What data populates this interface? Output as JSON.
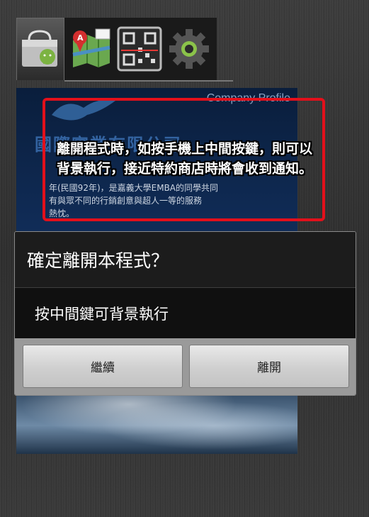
{
  "launcher": {
    "tabs": [
      {
        "icon": "shopping-bag-icon"
      },
      {
        "icon": "map-icon"
      },
      {
        "icon": "qr-code-icon"
      },
      {
        "icon": "gear-icon"
      }
    ]
  },
  "background_app": {
    "header_en": "Company Profile",
    "company_name": "國際實業有限公司",
    "intro_lines": [
      "年(民國92年)，是嘉義大學EMBA的同學共同",
      "有與眾不同的行銷創意與超人一等的服務",
      "熱忱。"
    ]
  },
  "annotation": {
    "text": "離開程式時，如按手機上中間按鍵，則可以背景執行，接近特約商店時將會收到通知。"
  },
  "dialog": {
    "title": "確定離開本程式？",
    "message": "按中間鍵可背景執行",
    "buttons": {
      "continue": "繼續",
      "leave": "離開"
    }
  },
  "colors": {
    "annotation_border": "#e3101b",
    "dialog_bg": "#1e1e1e",
    "button_bar": "#9a9a9a"
  }
}
